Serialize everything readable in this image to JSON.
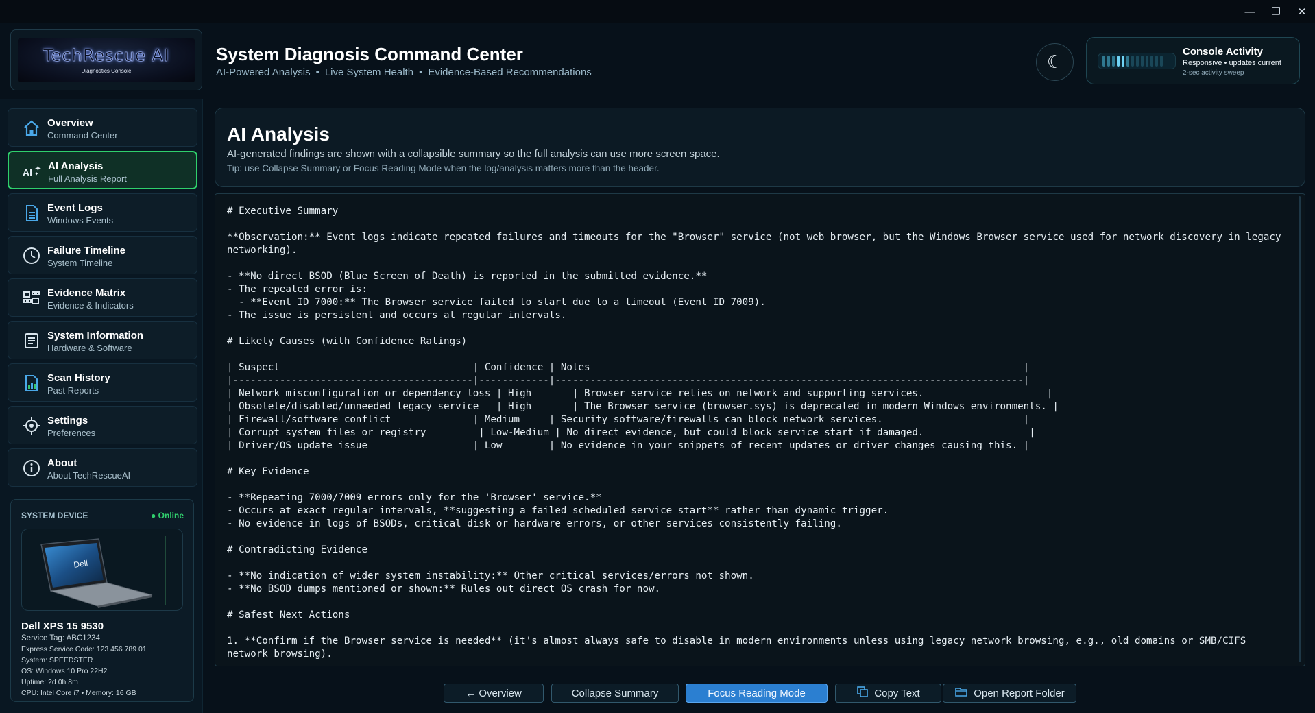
{
  "window": {
    "minimize": "—",
    "restore": "❐",
    "close": "✕"
  },
  "logo": {
    "title": "TechRescue AI",
    "subtitle": "Diagnostics Console"
  },
  "header": {
    "title": "System Diagnosis Command Center",
    "subtitle_parts": [
      "AI-Powered Analysis",
      "Live System Health",
      "Evidence-Based Recommendations"
    ],
    "separator": "•",
    "theme_icon": "☾",
    "activity": {
      "title": "Console Activity",
      "desc": "Responsive • updates current",
      "note": "2-sec activity sweep"
    }
  },
  "sidebar": {
    "items": [
      {
        "label": "Overview",
        "sub": "Command Center",
        "icon": "home-icon"
      },
      {
        "label": "AI Analysis",
        "sub": "Full Analysis Report",
        "icon": "ai-sparkle-icon",
        "active": true
      },
      {
        "label": "Event Logs",
        "sub": "Windows Events",
        "icon": "document-icon"
      },
      {
        "label": "Failure Timeline",
        "sub": "System Timeline",
        "icon": "clock-icon"
      },
      {
        "label": "Evidence Matrix",
        "sub": "Evidence & Indicators",
        "icon": "matrix-icon"
      },
      {
        "label": "System Information",
        "sub": "Hardware & Software",
        "icon": "list-icon"
      },
      {
        "label": "Scan History",
        "sub": "Past Reports",
        "icon": "bar-report-icon"
      },
      {
        "label": "Settings",
        "sub": "Preferences",
        "icon": "gear-icon"
      },
      {
        "label": "About",
        "sub": "About TechRescueAI",
        "icon": "info-icon"
      }
    ],
    "ai_icon_text": "AI",
    "device": {
      "heading": "SYSTEM DEVICE",
      "status": "● Online",
      "brand_on_image": "Dell",
      "name": "Dell XPS 15 9530",
      "service_tag": "Service Tag: ABC1234",
      "express_code": "Express Service Code: 123 456 789 01",
      "system": "System: SPEEDSTER",
      "os": "OS: Windows 10 Pro 22H2",
      "uptime": "Uptime: 2d 0h 8m",
      "cpu_mem": "CPU: Intel Core i7  •  Memory: 16 GB"
    }
  },
  "summary": {
    "title": "AI Analysis",
    "desc": "AI-generated findings are shown with a collapsible summary so the full analysis can use more screen space.",
    "tip": "Tip: use Collapse Summary or Focus Reading Mode when the log/analysis matters more than the header."
  },
  "report": {
    "text": "# Executive Summary\n\n**Observation:** Event logs indicate repeated failures and timeouts for the \"Browser\" service (not web browser, but the Windows Browser service used for network discovery in legacy networking).\n\n- **No direct BSOD (Blue Screen of Death) is reported in the submitted evidence.**\n- The repeated error is:\n  - **Event ID 7000:** The Browser service failed to start due to a timeout (Event ID 7009).\n- The issue is persistent and occurs at regular intervals.\n\n# Likely Causes (with Confidence Ratings)\n\n| Suspect                                 | Confidence | Notes                                                                          |\n|-----------------------------------------|------------|--------------------------------------------------------------------------------|\n| Network misconfiguration or dependency loss | High       | Browser service relies on network and supporting services.                     |\n| Obsolete/disabled/unneeded legacy service   | High       | The Browser service (browser.sys) is deprecated in modern Windows environments. |\n| Firewall/software conflict              | Medium     | Security software/firewalls can block network services.                        |\n| Corrupt system files or registry         | Low-Medium | No direct evidence, but could block service start if damaged.                  |\n| Driver/OS update issue                  | Low        | No evidence in your snippets of recent updates or driver changes causing this. |\n\n# Key Evidence\n\n- **Repeating 7000/7009 errors only for the 'Browser' service.**\n- Occurs at exact regular intervals, **suggesting a failed scheduled service start** rather than dynamic trigger.\n- No evidence in logs of BSODs, critical disk or hardware errors, or other services consistently failing.\n\n# Contradicting Evidence\n\n- **No indication of wider system instability:** Other critical services/errors not shown.\n- **No BSOD dumps mentioned or shown:** Rules out direct OS crash for now.\n\n# Safest Next Actions\n\n1. **Confirm if the Browser service is needed** (it's almost always safe to disable in modern environments unless using legacy network browsing, e.g., old domains or SMB/CIFS network browsing)."
  },
  "actions": {
    "overview": "←  Overview",
    "collapse": "Collapse Summary",
    "focus": "Focus Reading Mode",
    "copy": "Copy Text",
    "open_folder": "Open Report Folder"
  },
  "colors": {
    "accent": "#2fd06c",
    "primary_button": "#2b7fd1",
    "background": "#07111a"
  }
}
